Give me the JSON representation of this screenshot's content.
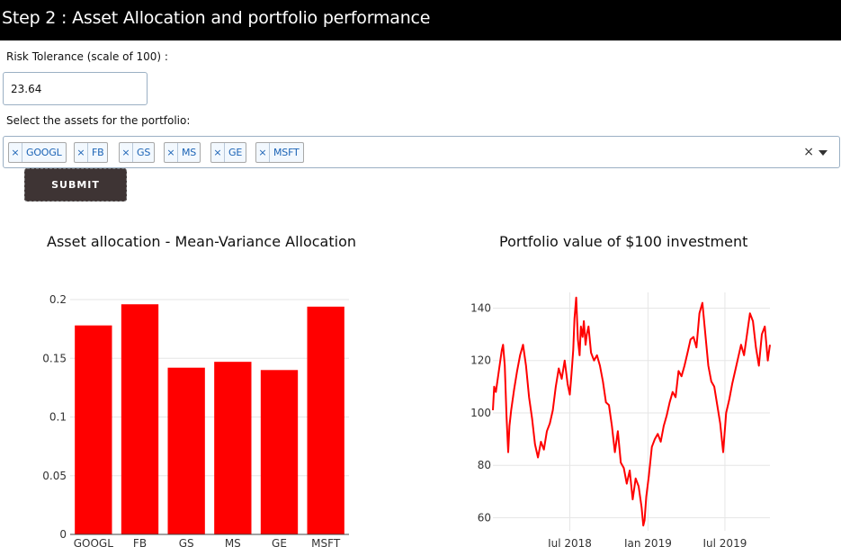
{
  "header": {
    "title": "Step 2 : Asset Allocation and portfolio performance"
  },
  "risk": {
    "label": "Risk Tolerance (scale of 100) :",
    "value": "23.64"
  },
  "assets": {
    "label": "Select the assets for the portfolio:",
    "selected": [
      "GOOGL",
      "FB",
      "GS",
      "MS",
      "GE",
      "MSFT"
    ],
    "remove_glyph": "×",
    "clear_glyph": "×"
  },
  "submit": {
    "label": "SUBMIT"
  },
  "colors": {
    "bar": "#ff0000",
    "line": "#ff0000",
    "header_bg": "#000000",
    "button_bg": "#3e3434"
  },
  "chart_data": [
    {
      "type": "bar",
      "title": "Asset allocation - Mean-Variance Allocation",
      "categories": [
        "GOOGL",
        "FB",
        "GS",
        "MS",
        "GE",
        "MSFT"
      ],
      "values": [
        0.178,
        0.196,
        0.142,
        0.147,
        0.14,
        0.194
      ],
      "ylim": [
        0,
        0.2
      ],
      "yticks": [
        0,
        0.05,
        0.1,
        0.15,
        0.2
      ],
      "ytick_labels": [
        "0",
        "0.05",
        "0.1",
        "0.15",
        "0.2"
      ],
      "grid": true,
      "xlabel": "",
      "ylabel": ""
    },
    {
      "type": "line",
      "title": "Portfolio value of $100 investment",
      "x_range": [
        "2018-01-01",
        "2019-10-15"
      ],
      "y_range": [
        55,
        146
      ],
      "yticks": [
        60,
        80,
        100,
        120,
        140
      ],
      "ytick_labels": [
        "60",
        "80",
        "100",
        "120",
        "140"
      ],
      "xticks": [
        "2018-07-01",
        "2019-01-01",
        "2019-07-01"
      ],
      "xtick_labels": [
        "Jul 2018",
        "Jan 2019",
        "Jul 2019"
      ],
      "grid": true,
      "xlabel": "",
      "ylabel": "",
      "series": [
        {
          "x": [
            "2018-01-01",
            "2018-01-04",
            "2018-01-08",
            "2018-01-15",
            "2018-01-22",
            "2018-01-25",
            "2018-01-29",
            "2018-02-02",
            "2018-02-06",
            "2018-02-09",
            "2018-02-13",
            "2018-02-20",
            "2018-02-27",
            "2018-03-06",
            "2018-03-13",
            "2018-03-20",
            "2018-03-27",
            "2018-04-03",
            "2018-04-10",
            "2018-04-17",
            "2018-04-24",
            "2018-05-01",
            "2018-05-08",
            "2018-05-15",
            "2018-05-22",
            "2018-05-29",
            "2018-06-05",
            "2018-06-12",
            "2018-06-19",
            "2018-06-26",
            "2018-07-01",
            "2018-07-05",
            "2018-07-09",
            "2018-07-12",
            "2018-07-16",
            "2018-07-20",
            "2018-07-24",
            "2018-07-27",
            "2018-07-31",
            "2018-08-03",
            "2018-08-07",
            "2018-08-10",
            "2018-08-14",
            "2018-08-20",
            "2018-08-27",
            "2018-09-03",
            "2018-09-10",
            "2018-09-17",
            "2018-09-24",
            "2018-10-01",
            "2018-10-08",
            "2018-10-15",
            "2018-10-22",
            "2018-10-29",
            "2018-11-05",
            "2018-11-12",
            "2018-11-19",
            "2018-11-26",
            "2018-12-03",
            "2018-12-10",
            "2018-12-17",
            "2018-12-21",
            "2018-12-24",
            "2018-12-28",
            "2019-01-03",
            "2019-01-10",
            "2019-01-17",
            "2019-01-24",
            "2019-01-31",
            "2019-02-07",
            "2019-02-14",
            "2019-02-21",
            "2019-02-28",
            "2019-03-07",
            "2019-03-14",
            "2019-03-21",
            "2019-03-28",
            "2019-04-04",
            "2019-04-11",
            "2019-04-18",
            "2019-04-25",
            "2019-05-02",
            "2019-05-09",
            "2019-05-16",
            "2019-05-23",
            "2019-05-30",
            "2019-06-06",
            "2019-06-13",
            "2019-06-20",
            "2019-06-27",
            "2019-07-04",
            "2019-07-11",
            "2019-07-18",
            "2019-07-25",
            "2019-08-01",
            "2019-08-08",
            "2019-08-15",
            "2019-08-22",
            "2019-08-29",
            "2019-09-05",
            "2019-09-12",
            "2019-09-19",
            "2019-09-26",
            "2019-10-03",
            "2019-10-10",
            "2019-10-15"
          ],
          "y": [
            101,
            110,
            108,
            116,
            124,
            126,
            118,
            99,
            85,
            95,
            101,
            109,
            116,
            122,
            126,
            118,
            106,
            98,
            88,
            83,
            89,
            86,
            93,
            96,
            101,
            110,
            117,
            113,
            120,
            111,
            107,
            115,
            124,
            136,
            144,
            128,
            122,
            133,
            129,
            135,
            126,
            130,
            133,
            123,
            120,
            122,
            118,
            112,
            104,
            103,
            95,
            85,
            93,
            81,
            79,
            73,
            78,
            67,
            75,
            72,
            64,
            57,
            59,
            68,
            76,
            87,
            90,
            92,
            89,
            95,
            99,
            104,
            108,
            106,
            116,
            114,
            118,
            123,
            128,
            129,
            125,
            138,
            142,
            130,
            118,
            112,
            110,
            103,
            96,
            85,
            100,
            105,
            111,
            116,
            121,
            126,
            122,
            130,
            138,
            135,
            125,
            118,
            130,
            133,
            120,
            126
          ]
        }
      ]
    }
  ]
}
